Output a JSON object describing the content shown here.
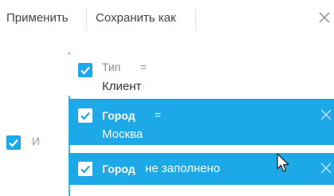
{
  "toolbar": {
    "apply_label": "Применить",
    "save_as_label": "Сохранить как"
  },
  "group": {
    "logic_label": "И",
    "logic_checked": true
  },
  "conditions": [
    {
      "field": "Тип",
      "operator": "=",
      "value": "Клиент",
      "checked": true,
      "selected": false
    },
    {
      "field": "Город",
      "operator": "=",
      "value": "Москва",
      "checked": true,
      "selected": true
    },
    {
      "field": "Город",
      "operator": "не заполнено",
      "value": "",
      "checked": true,
      "selected": true
    }
  ],
  "colors": {
    "accent": "#1da8e8",
    "line": "#3fb5e8"
  },
  "icons": [
    "close-icon",
    "check-icon",
    "cursor-icon"
  ]
}
